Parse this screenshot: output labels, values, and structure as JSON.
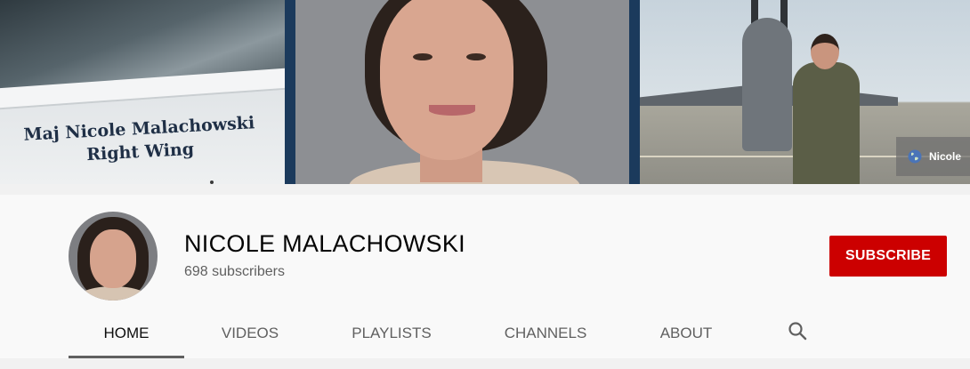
{
  "banner": {
    "decal_line1": "Maj Nicole Malachowski",
    "decal_line2": "Right Wing",
    "link_text": "Nicole",
    "link_icon": "globe-icon"
  },
  "channel": {
    "name": "NICOLE MALACHOWSKI",
    "subscribers": "698 subscribers",
    "subscribe_label": "SUBSCRIBE"
  },
  "tabs": [
    {
      "label": "HOME",
      "active": true
    },
    {
      "label": "VIDEOS",
      "active": false
    },
    {
      "label": "PLAYLISTS",
      "active": false
    },
    {
      "label": "CHANNELS",
      "active": false
    },
    {
      "label": "ABOUT",
      "active": false
    }
  ],
  "search_icon": "search-icon",
  "colors": {
    "subscribe": "#cc0000",
    "active_tab_indicator": "#606060",
    "header_background": "#f9f9f9"
  }
}
